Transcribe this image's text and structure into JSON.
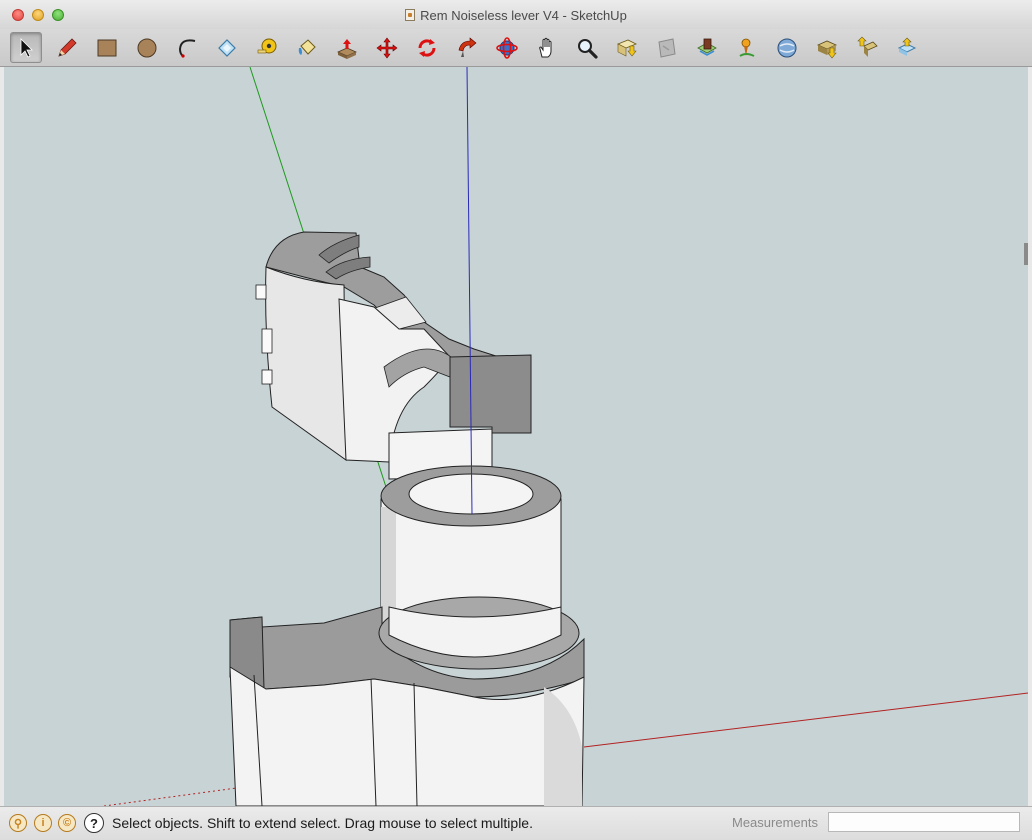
{
  "window": {
    "title": "Rem Noiseless lever V4 - SketchUp"
  },
  "toolbar": {
    "tools": [
      {
        "name": "select-tool",
        "icon": "arrow-cursor-icon"
      },
      {
        "name": "line-tool",
        "icon": "pencil-icon"
      },
      {
        "name": "rectangle-tool",
        "icon": "rectangle-icon"
      },
      {
        "name": "circle-tool",
        "icon": "circle-icon"
      },
      {
        "name": "arc-tool",
        "icon": "arc-icon"
      },
      {
        "name": "eraser-tool",
        "icon": "eraser-icon"
      },
      {
        "name": "tape-measure-tool",
        "icon": "tape-measure-icon"
      },
      {
        "name": "paint-bucket-tool",
        "icon": "paint-bucket-icon"
      },
      {
        "name": "push-pull-tool",
        "icon": "push-pull-icon"
      },
      {
        "name": "move-tool",
        "icon": "move-arrows-icon"
      },
      {
        "name": "rotate-tool",
        "icon": "rotate-icon"
      },
      {
        "name": "follow-me-tool",
        "icon": "follow-me-icon"
      },
      {
        "name": "orbit-tool",
        "icon": "orbit-icon"
      },
      {
        "name": "pan-tool",
        "icon": "hand-icon"
      },
      {
        "name": "zoom-tool",
        "icon": "magnifier-icon"
      },
      {
        "name": "zoom-extents-tool",
        "icon": "zoom-extents-icon"
      },
      {
        "name": "previous-view-tool",
        "icon": "previous-view-icon"
      },
      {
        "name": "get-models-tool",
        "icon": "warehouse-icon"
      },
      {
        "name": "add-location-tool",
        "icon": "location-pin-icon"
      },
      {
        "name": "toggle-terrain-tool",
        "icon": "globe-icon"
      },
      {
        "name": "share-model-tool",
        "icon": "share-model-icon"
      },
      {
        "name": "upload-component-tool",
        "icon": "upload-component-icon"
      },
      {
        "name": "extension-warehouse-tool",
        "icon": "extension-warehouse-icon"
      }
    ],
    "active_tool": "select-tool"
  },
  "viewport": {
    "background": "#c8d3d5",
    "axis_colors": {
      "red": "#b22222",
      "green": "#1e9a1e",
      "blue": "#2a2ab8"
    }
  },
  "status": {
    "icons": [
      "geo-location-icon",
      "credits-icon",
      "copyright-icon",
      "help-icon"
    ],
    "help_glyph": "?",
    "message": "Select objects. Shift to extend select. Drag mouse to select multiple.",
    "measurements_label": "Measurements",
    "measurements_value": ""
  }
}
